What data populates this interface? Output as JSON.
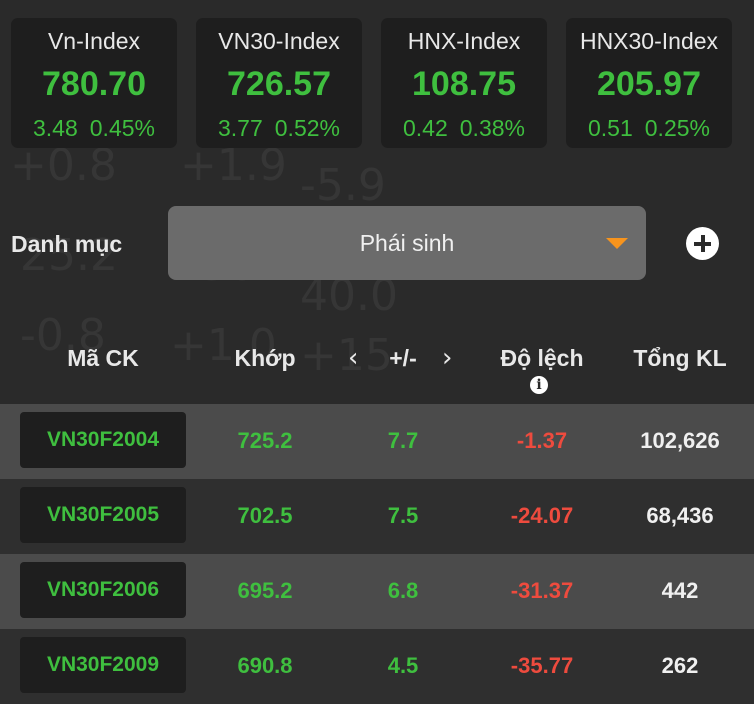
{
  "indices": [
    {
      "name": "Vn-Index",
      "value": "780.70",
      "change": "3.48",
      "percent": "0.45%"
    },
    {
      "name": "VN30-Index",
      "value": "726.57",
      "change": "3.77",
      "percent": "0.52%"
    },
    {
      "name": "HNX-Index",
      "value": "108.75",
      "change": "0.42",
      "percent": "0.38%"
    },
    {
      "name": "HNX30-Index",
      "value": "205.97",
      "change": "0.51",
      "percent": "0.25%"
    }
  ],
  "category": {
    "label": "Danh mục",
    "selected": "Phái sinh"
  },
  "table": {
    "headers": {
      "symbol": "Mã CK",
      "price": "Khớp",
      "change": "+/-",
      "deviation": "Độ lệch",
      "volume": "Tổng KL"
    },
    "rows": [
      {
        "symbol": "VN30F2004",
        "price": "725.2",
        "change": "7.7",
        "deviation": "-1.37",
        "volume": "102,626"
      },
      {
        "symbol": "VN30F2005",
        "price": "702.5",
        "change": "7.5",
        "deviation": "-24.07",
        "volume": "68,436"
      },
      {
        "symbol": "VN30F2006",
        "price": "695.2",
        "change": "6.8",
        "deviation": "-31.37",
        "volume": "442"
      },
      {
        "symbol": "VN30F2009",
        "price": "690.8",
        "change": "4.5",
        "deviation": "-35.77",
        "volume": "262"
      }
    ]
  },
  "colors": {
    "up": "#3fbf3f",
    "down": "#ee4b3e",
    "accent": "#f7941d"
  }
}
